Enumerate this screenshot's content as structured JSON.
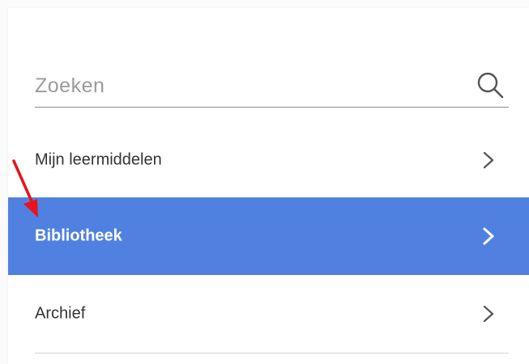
{
  "search": {
    "placeholder": "Zoeken",
    "icon": "search-icon"
  },
  "menu": {
    "items": [
      {
        "label": "Mijn leermiddelen",
        "icon": "chevron-right-icon",
        "selected": false
      },
      {
        "label": "Bibliotheek",
        "icon": "chevron-right-icon",
        "selected": true
      },
      {
        "label": "Archief",
        "icon": "chevron-right-icon",
        "selected": false
      }
    ]
  },
  "colors": {
    "selected_background": "#5081e0",
    "annotation_arrow": "#e8141a",
    "text": "#333333",
    "placeholder": "#9a9a9a"
  }
}
